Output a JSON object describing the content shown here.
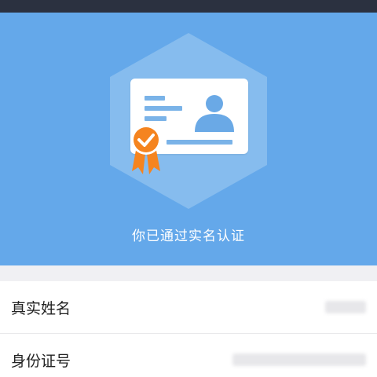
{
  "verification": {
    "status_text": "你已通过实名认证",
    "icon": "id-card-verified-icon"
  },
  "info": {
    "rows": [
      {
        "label": "真实姓名",
        "value": ""
      },
      {
        "label": "身份证号",
        "value": ""
      }
    ]
  },
  "colors": {
    "status_bar": "#2b3140",
    "hero_background": "#64a8ea",
    "hexagon": "#86bcee",
    "badge": "#f5841f",
    "card_accent": "#7ab3e8"
  }
}
